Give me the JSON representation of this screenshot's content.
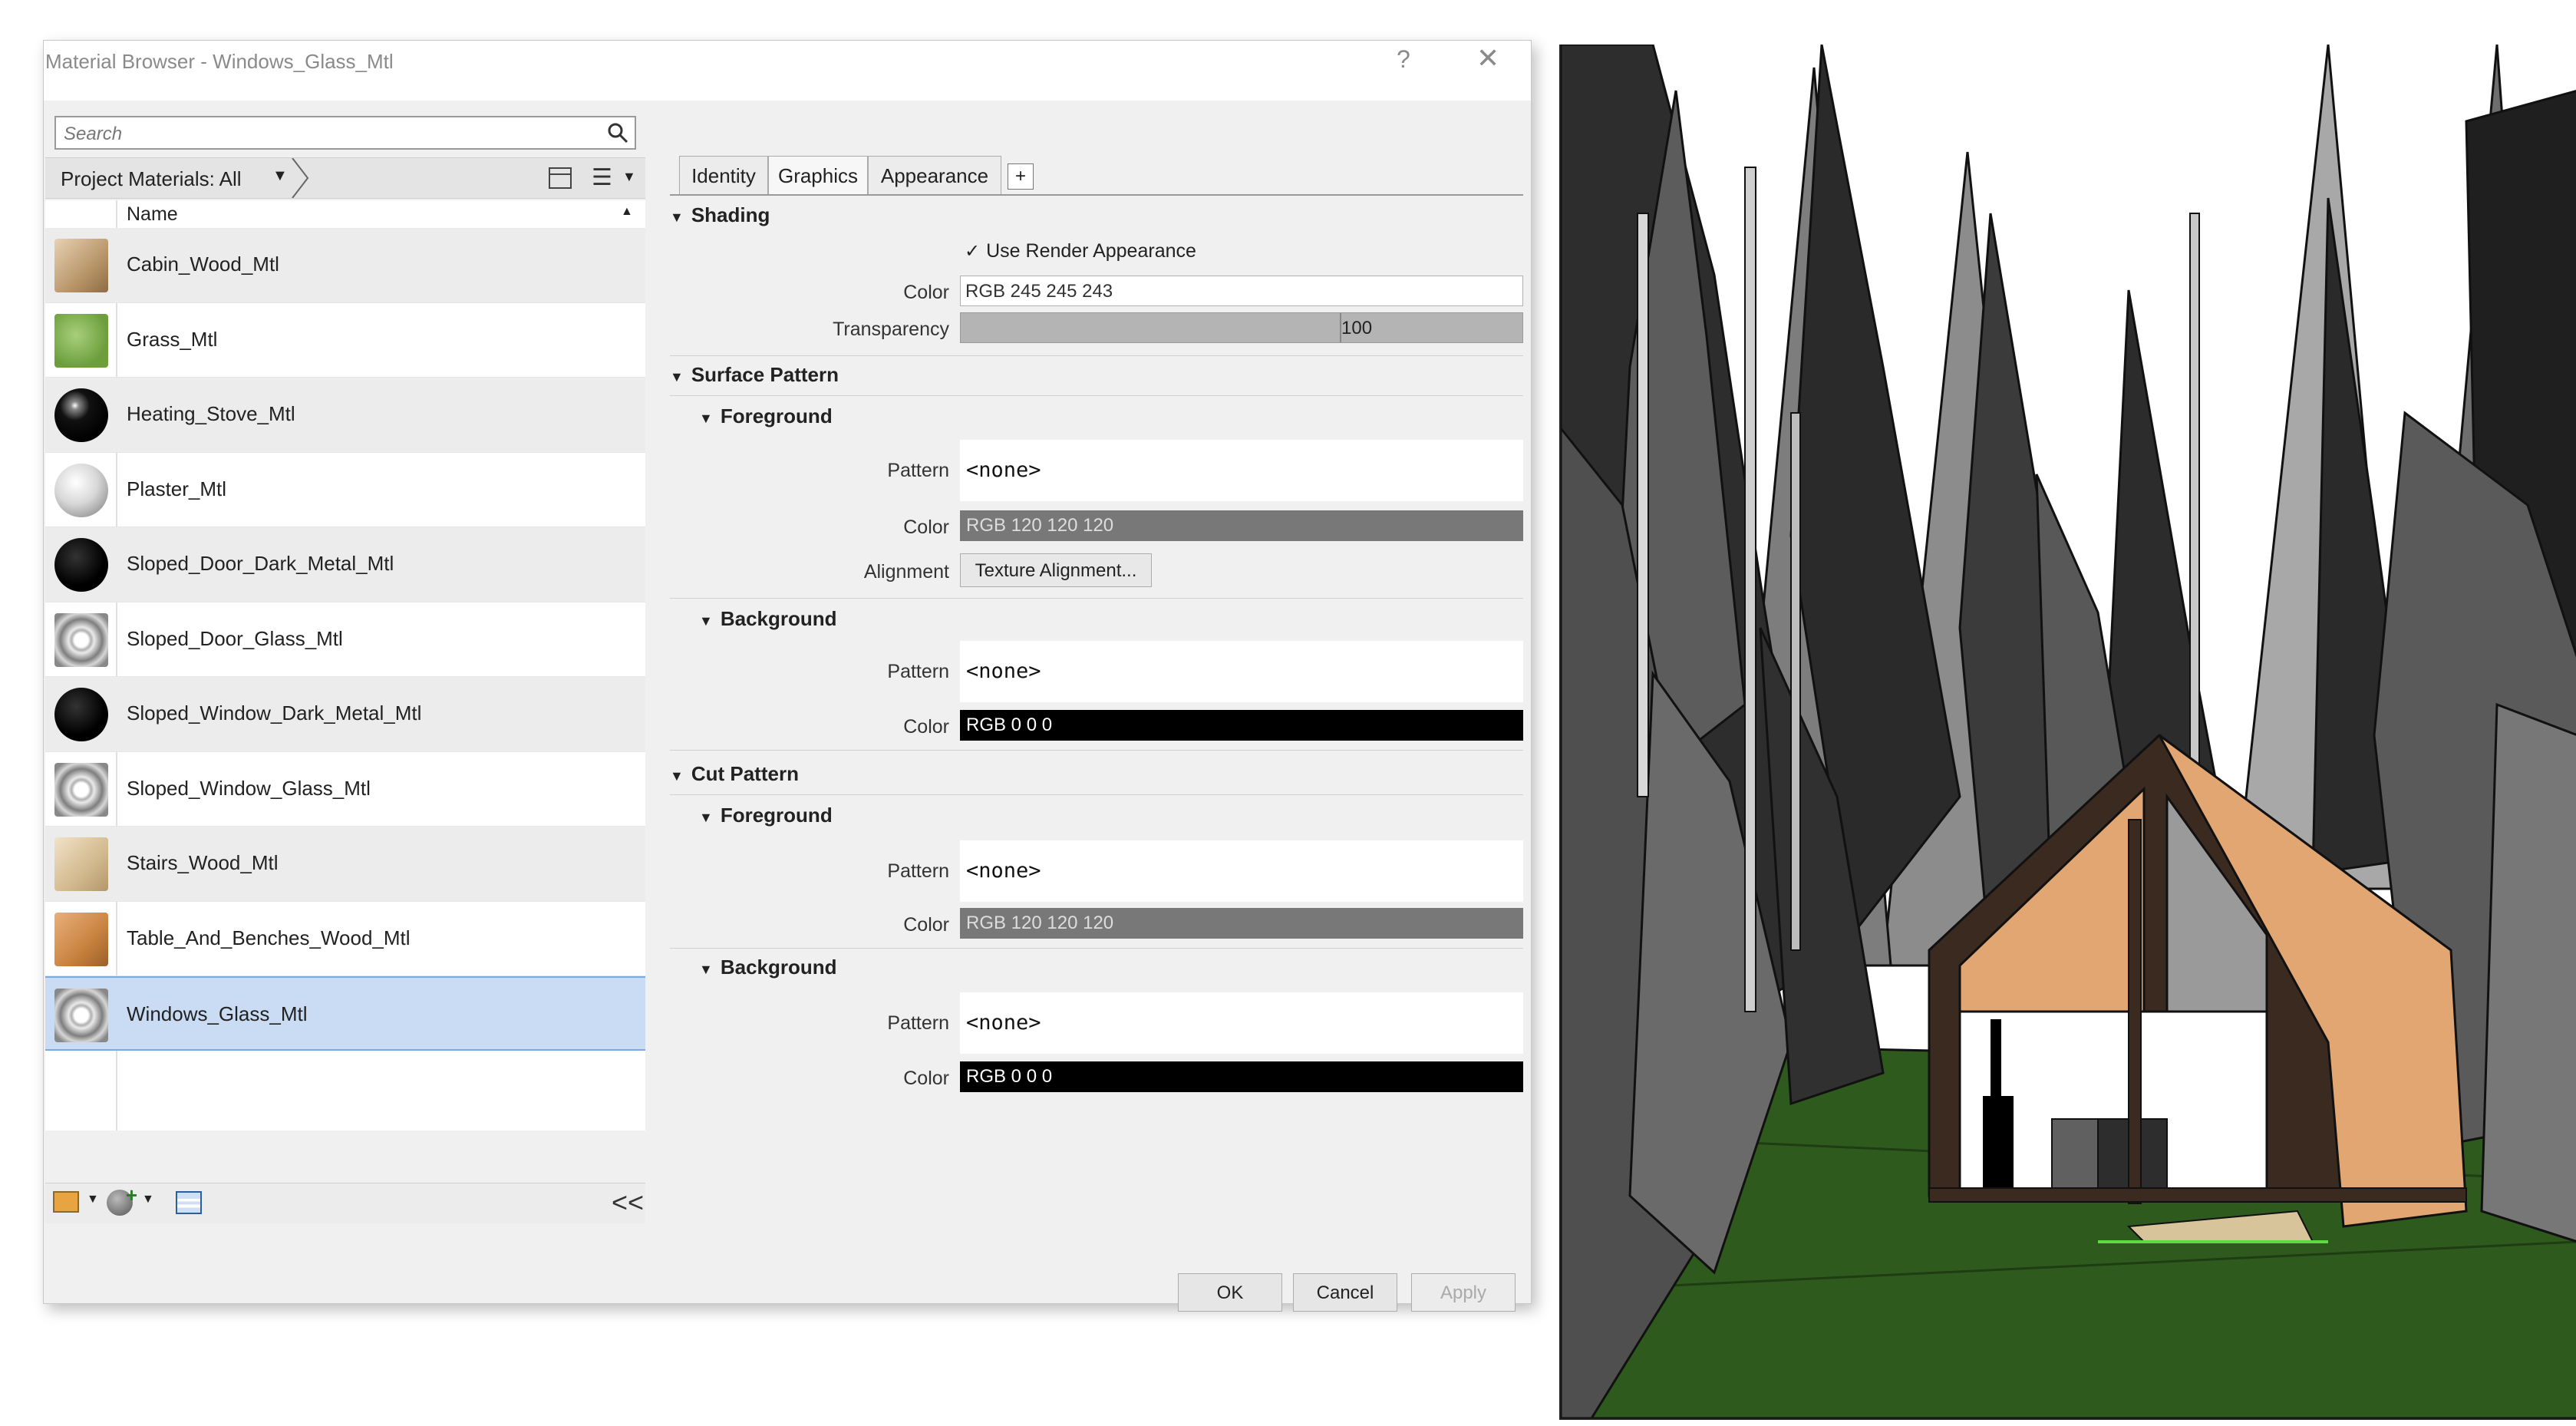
{
  "window": {
    "title": "Material Browser - Windows_Glass_Mtl",
    "help": "?",
    "close": "✕"
  },
  "search": {
    "placeholder": "Search"
  },
  "library": {
    "label": "Project Materials: All"
  },
  "list": {
    "column_header": "Name",
    "items": [
      {
        "label": "Cabin_Wood_Mtl",
        "thumb": "t-wood"
      },
      {
        "label": "Grass_Mtl",
        "thumb": "t-grass"
      },
      {
        "label": "Heating_Stove_Mtl",
        "thumb": "t-blackball"
      },
      {
        "label": "Plaster_Mtl",
        "thumb": "t-plaster"
      },
      {
        "label": "Sloped_Door_Dark_Metal_Mtl",
        "thumb": "t-darkmetal"
      },
      {
        "label": "Sloped_Door_Glass_Mtl",
        "thumb": "t-glass"
      },
      {
        "label": "Sloped_Window_Dark_Metal_Mtl",
        "thumb": "t-darkmetal"
      },
      {
        "label": "Sloped_Window_Glass_Mtl",
        "thumb": "t-glass"
      },
      {
        "label": "Stairs_Wood_Mtl",
        "thumb": "t-stairs"
      },
      {
        "label": "Table_And_Benches_Wood_Mtl",
        "thumb": "t-table"
      },
      {
        "label": "Windows_Glass_Mtl",
        "thumb": "t-glass",
        "selected": true
      }
    ]
  },
  "tabs": [
    "Identity",
    "Graphics",
    "Appearance"
  ],
  "tab_active": "Graphics",
  "tab_add": "+",
  "shading": {
    "title": "Shading",
    "use_render_appearance": "Use Render Appearance",
    "color_label": "Color",
    "color_value": "RGB 245 245 243",
    "transparency_label": "Transparency",
    "transparency_value": "100"
  },
  "surface_pattern": {
    "title": "Surface Pattern",
    "foreground": {
      "title": "Foreground",
      "pattern_label": "Pattern",
      "pattern_value": "<none>",
      "color_label": "Color",
      "color_value": "RGB 120 120 120",
      "alignment_label": "Alignment",
      "alignment_button": "Texture Alignment..."
    },
    "background": {
      "title": "Background",
      "pattern_label": "Pattern",
      "pattern_value": "<none>",
      "color_label": "Color",
      "color_value": "RGB 0 0 0"
    }
  },
  "cut_pattern": {
    "title": "Cut Pattern",
    "foreground": {
      "title": "Foreground",
      "pattern_label": "Pattern",
      "pattern_value": "<none>",
      "color_label": "Color",
      "color_value": "RGB 120 120 120"
    },
    "background": {
      "title": "Background",
      "pattern_label": "Pattern",
      "pattern_value": "<none>",
      "color_label": "Color",
      "color_value": "RGB 0 0 0"
    }
  },
  "collapse": "<<",
  "buttons": {
    "ok": "OK",
    "cancel": "Cancel",
    "apply": "Apply"
  },
  "colors": {
    "selection": "#c9dcf4",
    "swatch_gray": "#787878",
    "swatch_black": "#000000",
    "cabin_wood": "#e2a673",
    "cabin_frame": "#3b2a20",
    "grass": "#2f5a1e"
  }
}
